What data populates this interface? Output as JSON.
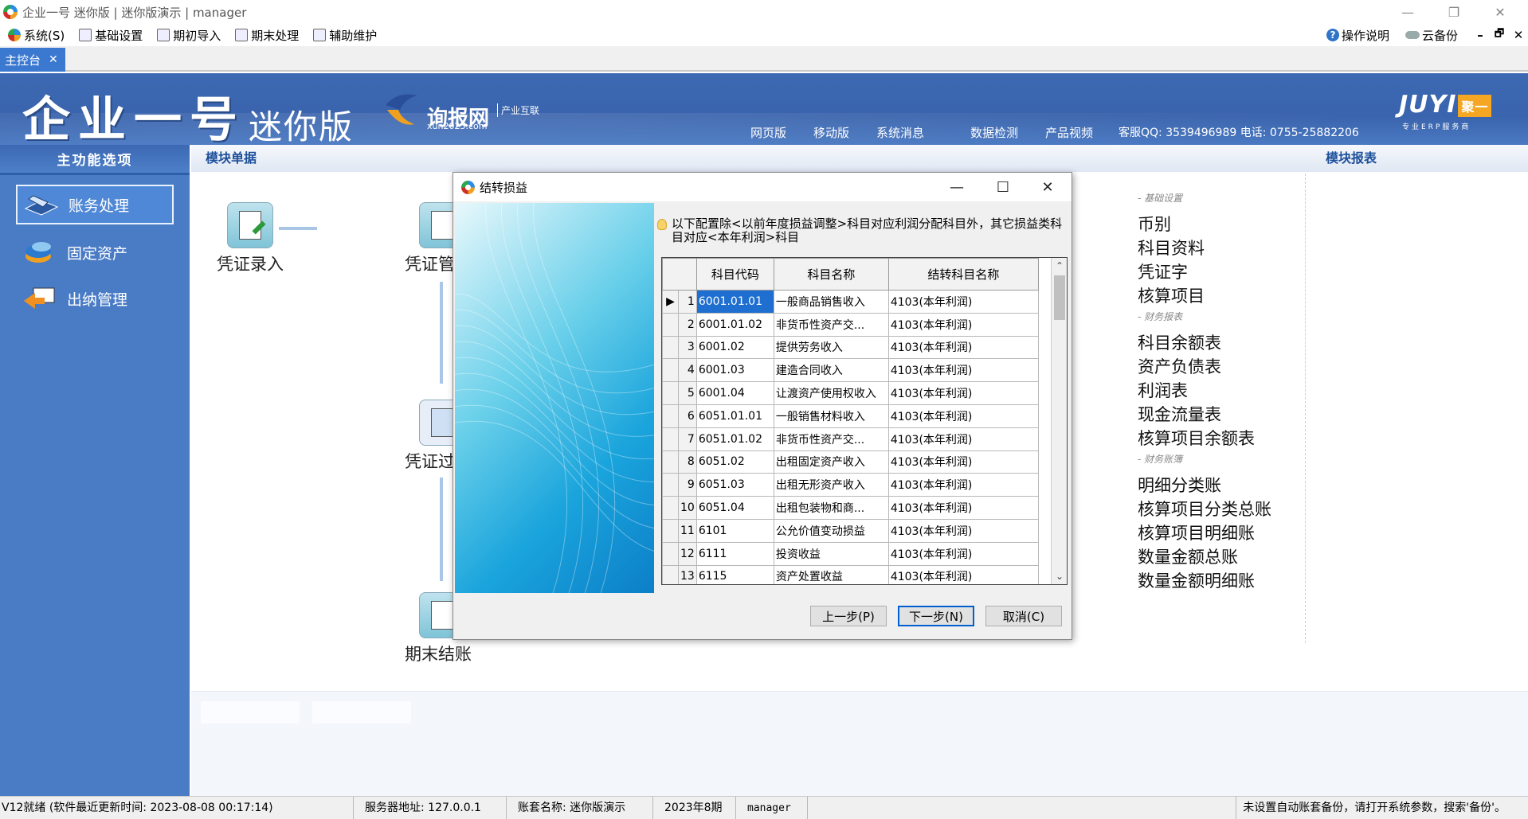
{
  "window": {
    "title": "企业一号 迷你版 | 迷你版演示 | manager",
    "controls": [
      "—",
      "❐",
      "✕"
    ]
  },
  "menu": {
    "items": [
      "系统(S)",
      "基础设置",
      "期初导入",
      "期末处理",
      "辅助维护"
    ],
    "help": "操作说明",
    "cloud_backup": "云备份",
    "mdi_controls": [
      "–",
      "🗗",
      "✕"
    ]
  },
  "tabs": [
    {
      "label": "主控台",
      "close": "✕"
    }
  ],
  "banner": {
    "product_name": "企业一号",
    "product_edition": "迷你版",
    "partner_name": "询报网",
    "partner_url": "xun2025.com",
    "partner_tag": "产业互联",
    "links": [
      "网页版",
      "移动版",
      "系统消息",
      "数据检测",
      "产品视频"
    ],
    "contact": "客服QQ: 3539496989  电话: 0755-25882206",
    "brand_logo": "JUYI",
    "brand_badge": "聚一",
    "brand_sub": "专业ERP服务商"
  },
  "left_nav": {
    "header": "主功能选项",
    "items": [
      {
        "label": "账务处理",
        "icon": "ledger-icon",
        "active": true
      },
      {
        "label": "固定资产",
        "icon": "assets-icon",
        "active": false
      },
      {
        "label": "出纳管理",
        "icon": "cashier-icon",
        "active": false
      }
    ]
  },
  "main": {
    "module_docs_title": "模块单据",
    "module_reports_title": "模块报表",
    "flow": [
      "凭证录入",
      "凭证管",
      "凭证过",
      "期末结账"
    ]
  },
  "reports": {
    "groups": [
      {
        "category": "- 基础设置",
        "items": [
          "币别",
          "科目资料",
          "凭证字",
          "核算项目"
        ]
      },
      {
        "category": "- 财务报表",
        "items": [
          "科目余额表",
          "资产负债表",
          "利润表",
          "现金流量表",
          "核算项目余额表"
        ]
      },
      {
        "category": "- 财务账簿",
        "items": [
          "明细分类账",
          "核算项目分类总账",
          "核算项目明细账",
          "数量金额总账",
          "数量金额明细账"
        ]
      }
    ]
  },
  "dialog": {
    "title": "结转损益",
    "hint": "以下配置除<以前年度损益调整>科目对应利润分配科目外，其它损益类科目对应<本年利润>科目",
    "columns": [
      "科目代码",
      "科目名称",
      "结转科目名称"
    ],
    "rows": [
      {
        "n": "1",
        "code": "6001.01.01",
        "name": "一般商品销售收入",
        "target": "4103(本年利润)"
      },
      {
        "n": "2",
        "code": "6001.01.02",
        "name": "非货币性资产交...",
        "target": "4103(本年利润)"
      },
      {
        "n": "3",
        "code": "6001.02",
        "name": "提供劳务收入",
        "target": "4103(本年利润)"
      },
      {
        "n": "4",
        "code": "6001.03",
        "name": "建造合同收入",
        "target": "4103(本年利润)"
      },
      {
        "n": "5",
        "code": "6001.04",
        "name": "让渡资产使用权收入",
        "target": "4103(本年利润)"
      },
      {
        "n": "6",
        "code": "6051.01.01",
        "name": "一般销售材料收入",
        "target": "4103(本年利润)"
      },
      {
        "n": "7",
        "code": "6051.01.02",
        "name": "非货币性资产交...",
        "target": "4103(本年利润)"
      },
      {
        "n": "8",
        "code": "6051.02",
        "name": "出租固定资产收入",
        "target": "4103(本年利润)"
      },
      {
        "n": "9",
        "code": "6051.03",
        "name": "出租无形资产收入",
        "target": "4103(本年利润)"
      },
      {
        "n": "10",
        "code": "6051.04",
        "name": "出租包装物和商...",
        "target": "4103(本年利润)"
      },
      {
        "n": "11",
        "code": "6101",
        "name": "公允价值变动损益",
        "target": "4103(本年利润)"
      },
      {
        "n": "12",
        "code": "6111",
        "name": "投资收益",
        "target": "4103(本年利润)"
      },
      {
        "n": "13",
        "code": "6115",
        "name": "资产处置收益",
        "target": "4103(本年利润)"
      }
    ],
    "buttons": {
      "prev": "上一步(P)",
      "next": "下一步(N)",
      "cancel": "取消(C)"
    }
  },
  "status": {
    "ready": "V12就绪 (软件最近更新时间: 2023-08-08 00:17:14)",
    "server": "服务器地址: 127.0.0.1",
    "account_set": "账套名称: 迷你版演示",
    "period": "2023年8期",
    "user": "manager",
    "notice": "未设置自动账套备份，请打开系统参数，搜索'备份'。"
  },
  "colors": {
    "banner_blue": "#3c68b3",
    "nav_blue": "#4a7cc6",
    "tab_blue": "#3b78d0",
    "selection_blue": "#1e6fd0",
    "link_blue": "#1d4f9a"
  }
}
